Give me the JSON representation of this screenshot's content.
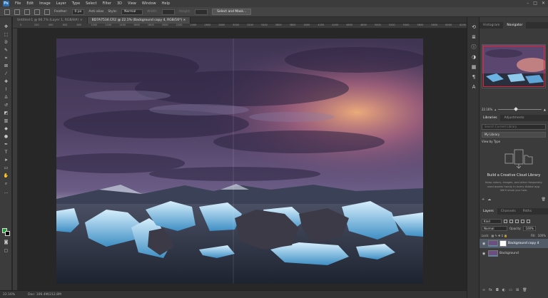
{
  "app": {
    "logo": "Ps"
  },
  "menu": [
    "File",
    "Edit",
    "Image",
    "Layer",
    "Type",
    "Select",
    "Filter",
    "3D",
    "View",
    "Window",
    "Help"
  ],
  "window_controls": [
    "–",
    "□",
    "✕"
  ],
  "options": {
    "feather_label": "Feather:",
    "feather_value": "0 px",
    "antialias_label": "Anti-alias",
    "style_label": "Style:",
    "style_value": "Normal",
    "width_label": "Width:",
    "height_label": "Height:",
    "select_mask_button": "Select and Mask..."
  },
  "doc_tabs": [
    {
      "label": "Untitled-1 @ 66.7% (Layer 1, RGB/8#)  ×",
      "active": false
    },
    {
      "label": "BD7A7534.CR2 @ 22.1% (Background copy 4, RGB/16*)  ×",
      "active": true
    }
  ],
  "ruler_ticks": [
    "0",
    "200",
    "400",
    "600",
    "800",
    "1000",
    "1200",
    "1400",
    "1600",
    "1800",
    "2000",
    "2200",
    "2400",
    "2600",
    "2800",
    "3000",
    "3200",
    "3400",
    "3600",
    "3800",
    "4000",
    "4200",
    "4400",
    "4600",
    "4800",
    "5000",
    "5200",
    "5400",
    "5600",
    "5800",
    "6000",
    "6200"
  ],
  "status": {
    "zoom": "22.16%",
    "doc": "Doc: 106.4M/212.8M"
  },
  "navigator": {
    "tabs": [
      "Histogram",
      "Navigator"
    ],
    "zoom": "22.16%"
  },
  "libraries": {
    "tabs": [
      "Libraries",
      "Adjustments"
    ],
    "search_placeholder": "Search Current Library",
    "library_select": "My Library",
    "view_by": "View by Type",
    "title": "Build a Creative Cloud Library",
    "description": "Keep colors, images, and other frequently used assets handy in every Adobe app. We'll show you how."
  },
  "layers": {
    "tabs": [
      "Layers",
      "Channels",
      "Paths"
    ],
    "kind_label": "Kind",
    "blend_mode": "Normal",
    "opacity_label": "Opacity:",
    "opacity_value": "100%",
    "lock_label": "Lock:",
    "fill_label": "Fill:",
    "fill_value": "100%",
    "items": [
      {
        "name": "Background copy 4",
        "active": true,
        "has_mask": true
      },
      {
        "name": "Background",
        "active": false,
        "has_mask": false
      }
    ]
  }
}
